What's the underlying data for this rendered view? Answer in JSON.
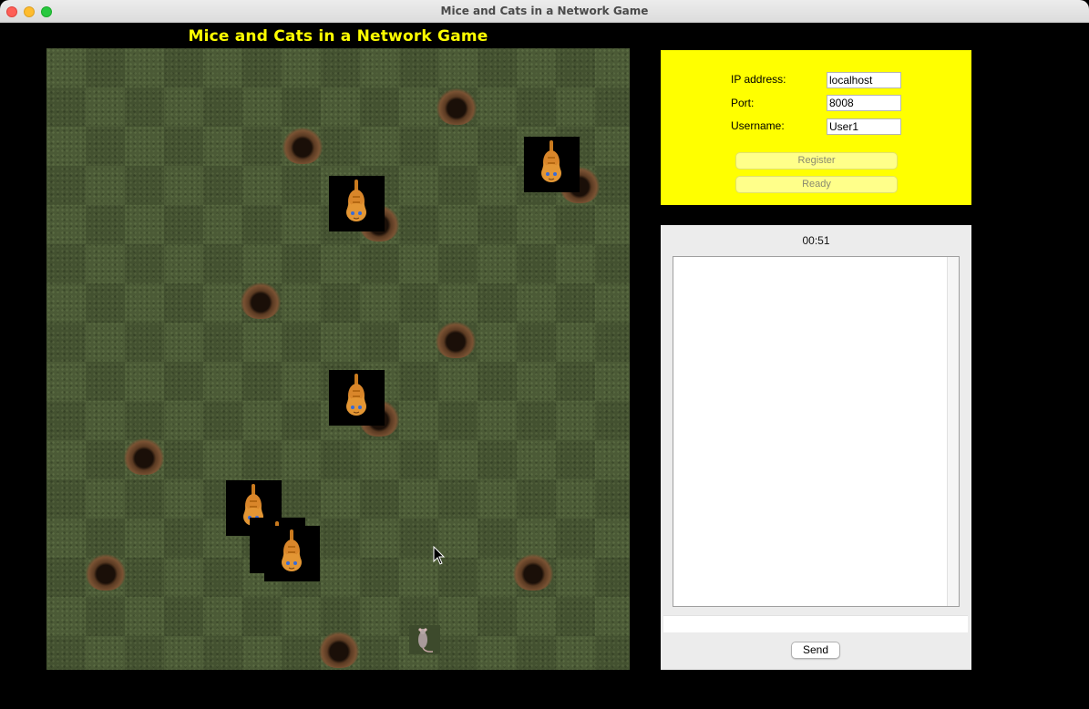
{
  "window": {
    "title": "Mice and Cats in a Network Game"
  },
  "game": {
    "title": "Mice and Cats in a Network Game"
  },
  "connection": {
    "ip_label": "IP address:",
    "ip_value": "localhost",
    "port_label": "Port:",
    "port_value": "8008",
    "username_label": "Username:",
    "username_value": "User1",
    "register_label": "Register",
    "ready_label": "Ready"
  },
  "chat": {
    "timer": "00:51",
    "message_value": "",
    "send_label": "Send"
  },
  "colors": {
    "connection_panel": "#ffff00",
    "title_text": "#ffff00",
    "board_grass": "#4b5a36"
  },
  "icons": {
    "cat": "cat-icon",
    "mouse": "mouse-icon",
    "hole": "mouse-hole-icon"
  }
}
